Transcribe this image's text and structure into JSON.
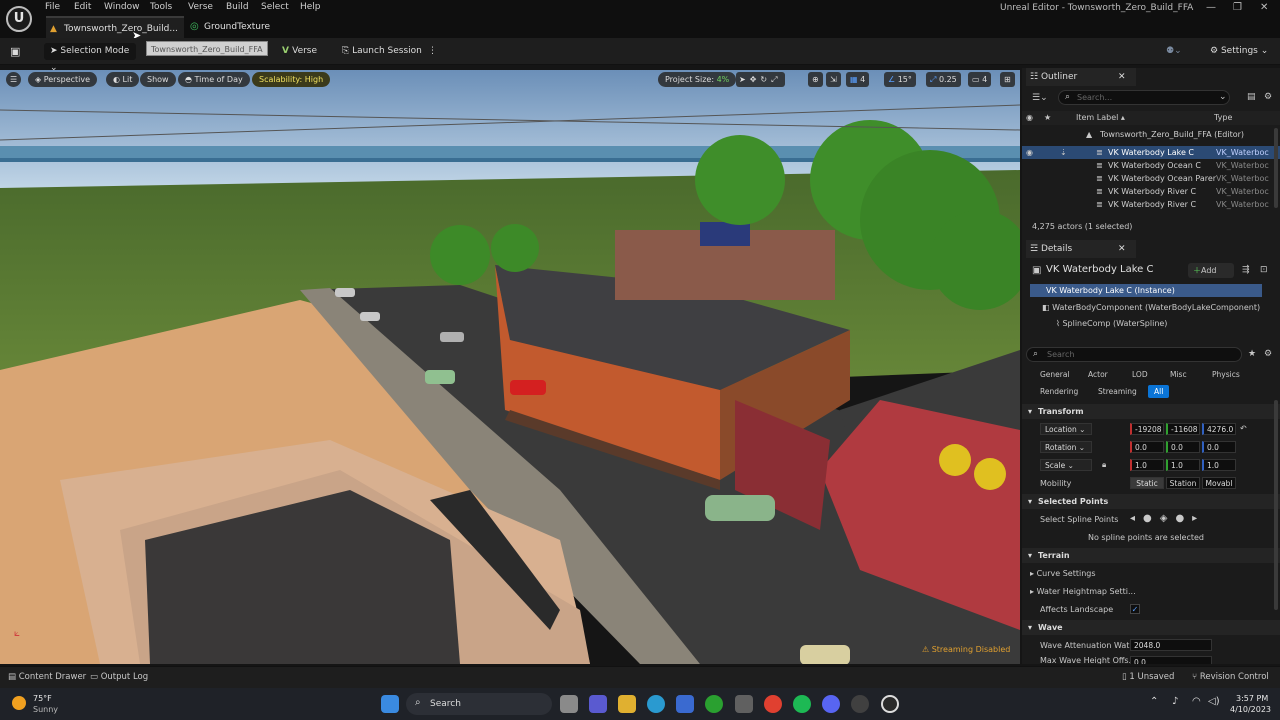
{
  "menubar": {
    "items": [
      "File",
      "Edit",
      "Window",
      "Tools",
      "Verse",
      "Build",
      "Select",
      "Help"
    ],
    "window_title": "Unreal Editor - Townsworth_Zero_Build_FFA"
  },
  "tabs": [
    {
      "label": "Townsworth_Zero_Build..."
    },
    {
      "label": "GroundTexture"
    }
  ],
  "tooltip": "Townsworth_Zero_Build_FFA",
  "toolbar": {
    "selection_mode": "Selection Mode",
    "verse": "Verse",
    "launch_session": "Launch Session",
    "settings": "Settings"
  },
  "viewport": {
    "perspective": "Perspective",
    "lit": "Lit",
    "show": "Show",
    "time_of_day": "Time of Day",
    "scalability": "Scalability: High",
    "project_size_label": "Project Size:",
    "project_size_value": "4%",
    "grid_value": "4",
    "rotation_snap": "15°",
    "scale_snap": "0.25",
    "camera_speed": "4",
    "streaming": "Streaming Disabled"
  },
  "outliner": {
    "title": "Outliner",
    "search_placeholder": "Search...",
    "col_label": "Item Label ▴",
    "col_type": "Type",
    "root": "Townsworth_Zero_Build_FFA (Editor)",
    "rows": [
      {
        "label": "VK Waterbody Lake C",
        "type": "VK_Waterboc"
      },
      {
        "label": "VK Waterbody Ocean C",
        "type": "VK_Waterboc"
      },
      {
        "label": "VK Waterbody Ocean Parer",
        "type": "VK_Waterboc"
      },
      {
        "label": "VK Waterbody River C",
        "type": "VK_Waterboc"
      },
      {
        "label": "VK Waterbody River C",
        "type": "VK_Waterboc"
      }
    ],
    "status": "4,275 actors (1 selected)"
  },
  "details": {
    "title": "Details",
    "object_name": "VK Waterbody Lake C",
    "add": "Add",
    "tree": [
      "VK Waterbody Lake C (Instance)",
      "WaterBodyComponent (WaterBodyLakeComponent)",
      "SplineComp (WaterSpline)"
    ],
    "search_placeholder": "Search",
    "categories_row1": [
      "General",
      "Actor",
      "LOD",
      "Misc",
      "Physics"
    ],
    "categories_row2": [
      "Rendering",
      "Streaming",
      "All"
    ],
    "transform": {
      "header": "Transform",
      "location_label": "Location",
      "location": [
        "-19208",
        "-11608",
        "4276.0"
      ],
      "rotation_label": "Rotation",
      "rotation": [
        "0.0",
        "0.0",
        "0.0"
      ],
      "scale_label": "Scale",
      "scale": [
        "1.0",
        "1.0",
        "1.0"
      ],
      "mobility_label": "Mobility",
      "mobility": [
        "Static",
        "Station",
        "Movabl"
      ]
    },
    "selected_points": {
      "header": "Selected Points",
      "label": "Select Spline Points",
      "none": "No spline points are selected"
    },
    "terrain": {
      "header": "Terrain",
      "curve": "Curve Settings",
      "heightmap": "Water Heightmap Setti...",
      "affects": "Affects Landscape"
    },
    "wave": {
      "header": "Wave",
      "attenuation_label": "Wave Attenuation Wat...",
      "attenuation_value": "2048.0",
      "max_height_label": "Max Wave Height Offs...",
      "max_height_value": "0.0"
    }
  },
  "bottombar": {
    "content_drawer": "Content Drawer",
    "output_log": "Output Log",
    "unsaved": "1 Unsaved",
    "revision": "Revision Control"
  },
  "taskbar": {
    "weather_temp": "75°F",
    "weather_desc": "Sunny",
    "search": "Search",
    "time": "3:57 PM",
    "date": "4/10/2023"
  },
  "colors": {
    "accent": "#0a74d6",
    "selection": "#2b4a74",
    "scalability": "#f0e060",
    "streaming_warning": "#e0a030"
  }
}
